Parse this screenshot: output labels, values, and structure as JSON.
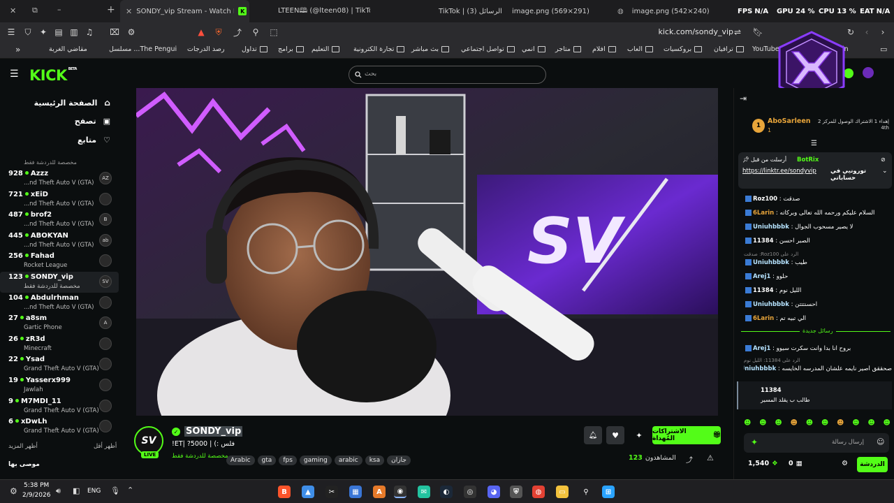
{
  "browser": {
    "tabs": [
      {
        "title": "SONDY_vip Stream - Watch L",
        "active": true
      },
      {
        "title": "LTEEN🕮 (@lteen08) | TikTok",
        "active": false
      },
      {
        "title": "TikTok | الرسائل (3)",
        "active": false
      },
      {
        "title": "image.png (569×291)",
        "active": false
      },
      {
        "title": "image.png (542×240)",
        "active": false
      }
    ],
    "stats": {
      "fps_label": "FPS",
      "fps_value": "N/A",
      "gpu": "GPU 24 %",
      "cpu": "CPU 13 %",
      "eat_label": "EAT",
      "eat_value": "N/A"
    },
    "url": "kick.com/sondy_vip",
    "bookmarks": [
      "YouTube",
      "ترافيان",
      "بروكسيات",
      "العاب",
      "افلام",
      "متاجر",
      "انمي",
      "تواصل اجتماعي",
      "بث مباشر",
      "تجارة الكترونية",
      "التعليم",
      "برامج",
      "تداول",
      "رصد الدرجات",
      "The Pengui... مسلسل",
      "مقاضي الغربة"
    ],
    "bookmark_more": "»",
    "bookmark_right_partial": "in"
  },
  "kick": {
    "logo": "KICK",
    "logo_badge": "BETA",
    "search_placeholder": "بحث",
    "nav": [
      {
        "label": "الصفحة الرئيسية",
        "icon": "home-icon"
      },
      {
        "label": "تصفح",
        "icon": "browse-icon"
      },
      {
        "label": "متابع",
        "icon": "heart-icon"
      }
    ],
    "section_note": "مخصصة للدردشة فقط",
    "channels": [
      {
        "viewers": "928",
        "name": "Azzz",
        "category": "...nd Theft Auto V (GTA)",
        "avatar": "AZ"
      },
      {
        "viewers": "721",
        "name": "xEiD",
        "category": "...nd Theft Auto V (GTA)",
        "avatar": ""
      },
      {
        "viewers": "487",
        "name": "brof2",
        "category": "...nd Theft Auto V (GTA)",
        "avatar": "B"
      },
      {
        "viewers": "445",
        "name": "ABOKYAN",
        "category": "...nd Theft Auto V (GTA)",
        "avatar": "ab"
      },
      {
        "viewers": "256",
        "name": "Fahad",
        "category": "Rocket League",
        "avatar": ""
      },
      {
        "viewers": "123",
        "name": "SONDY_vip",
        "category": "مخصصة للدردشة فقط",
        "avatar": "SV",
        "selected": true
      },
      {
        "viewers": "104",
        "name": "Abdulrhman",
        "category": "...nd Theft Auto V (GTA)",
        "avatar": ""
      },
      {
        "viewers": "27",
        "name": "a8sm",
        "category": "Gartic Phone",
        "avatar": "A"
      },
      {
        "viewers": "26",
        "name": "zR3d",
        "category": "Minecraft",
        "avatar": ""
      },
      {
        "viewers": "22",
        "name": "Ysad",
        "category": "Grand Theft Auto V (GTA)",
        "avatar": ""
      },
      {
        "viewers": "19",
        "name": "Yasserx999",
        "category": "Jawlah",
        "avatar": ""
      },
      {
        "viewers": "9",
        "name": "M7MDI_11",
        "category": "Grand Theft Auto V (GTA)",
        "avatar": ""
      },
      {
        "viewers": "6",
        "name": "xDwLh",
        "category": "Grand Theft Auto V (GTA)",
        "avatar": ""
      }
    ],
    "show_more": "أظهر المزيد",
    "show_less": "أظهر أقل",
    "recommended": "موصى بها",
    "stream": {
      "channel": "SONDY_vip",
      "live": "LIVE",
      "title": "فلس :) | 5000? |ET!",
      "category": "مخصصة للدردشة فقط",
      "tags": [
        "Arabic",
        "gta",
        "fps",
        "gaming",
        "arabic",
        "ksa",
        "جازان"
      ],
      "gift_button": "الاشتراكات المُهداة",
      "viewers_label": "المشاهدون",
      "viewers": "123"
    },
    "chat": {
      "top_gifter": {
        "name": "AboSarleen",
        "rank": "1",
        "count": "1",
        "note": "إهداء 1 الاشتراك الوصول للمركز 2 4th"
      },
      "pinned": {
        "user": "BotRix",
        "label": "أرسلت من قبل",
        "text": "تورونيي في حساباتي",
        "link": "https://linktr.ee/sondyvip"
      },
      "messages": [
        {
          "user": "Roz100",
          "text": "صدقت",
          "color": "#ffffff"
        },
        {
          "user": "6Larin",
          "text": "السلام عليكم ورحمه الله تعالى وبركاته",
          "color": "#e8a53a"
        },
        {
          "user": "Uniuhbbbk",
          "text": "لا يصير مسحوب الجوال",
          "color": "#b6e3ff"
        },
        {
          "user": "11384",
          "text": "الصبر احسن",
          "color": "#ffffff"
        },
        {
          "user": "Uniuhbbbk",
          "text": "طيب",
          "color": "#b6e3ff",
          "reply": "الرد على Roz100: صدقت"
        },
        {
          "user": "Arej1",
          "text": "حلوو",
          "color": "#b6e3ff"
        },
        {
          "user": "11384",
          "text": "الليل نوم",
          "color": "#ffffff"
        },
        {
          "user": "Uniuhbbbk",
          "text": "احسنتتتن",
          "color": "#b6e3ff"
        },
        {
          "user": "6Larin",
          "text": "الي تبيه تم",
          "color": "#e8a53a"
        }
      ],
      "new_messages": "رسائل جديدة",
      "after": [
        {
          "user": "Arej1",
          "text": "بروح انا بدا وانت سكرت سيوو",
          "color": "#b6e3ff"
        },
        {
          "user": "Uniuhbbbk",
          "text": "صحققق أصير نايمه علشان المدرسه الخايسه",
          "color": "#b6e3ff",
          "reply": "الرد على 11384: الليل نوم"
        }
      ],
      "highlight": {
        "user": "11384",
        "text": "طالب ب يقلد المسير"
      },
      "input_placeholder": "إرسال رسالة",
      "points": "1,540",
      "subs": "0",
      "chat_button": "الدردشة"
    }
  },
  "taskbar": {
    "time": "5:38 PM",
    "date": "2/9/2026",
    "lang": "ENG"
  },
  "colors": {
    "kick_green": "#53fc18",
    "bg": "#0b0e0f",
    "chat_gold": "#e8a53a"
  }
}
